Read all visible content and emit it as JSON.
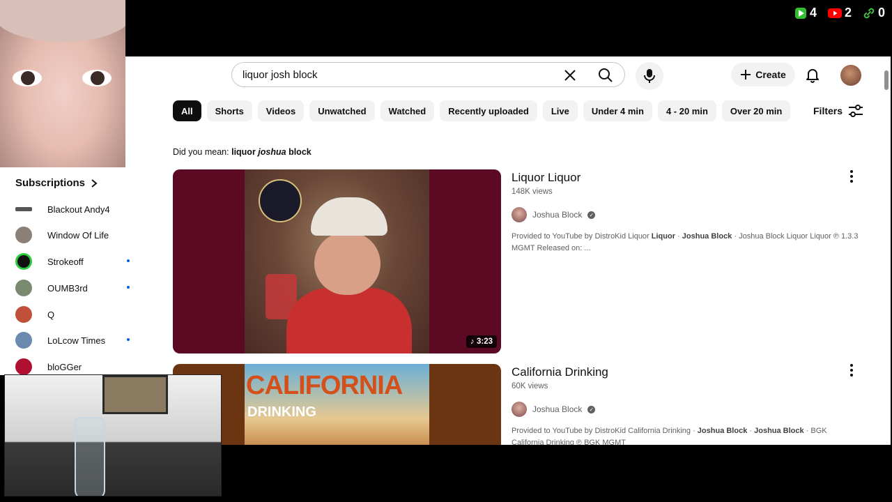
{
  "overlay": {
    "counters": [
      {
        "icon": "play-icon",
        "value": "4",
        "color": "#2fbf2f"
      },
      {
        "icon": "youtube-icon",
        "value": "2",
        "color": "#ff0000"
      },
      {
        "icon": "link-icon",
        "value": "0",
        "color": "#3fbf3f"
      }
    ]
  },
  "header": {
    "search_value": "liquor josh block",
    "create_label": "Create"
  },
  "chips": [
    "All",
    "Shorts",
    "Videos",
    "Unwatched",
    "Watched",
    "Recently uploaded",
    "Live",
    "Under 4 min",
    "4 - 20 min",
    "Over 20 min"
  ],
  "filters_label": "Filters",
  "did_you_mean": {
    "prefix": "Did you mean:",
    "part1": "liquor",
    "part2": "joshua",
    "part3": "block"
  },
  "results": [
    {
      "title": "Liquor Liquor",
      "views": "148K views",
      "channel": "Joshua Block",
      "duration": "3:23",
      "desc_a": "Provided to YouTube by DistroKid Liquor ",
      "desc_b": "Liquor",
      "desc_c": " · ",
      "desc_d": "Joshua Block",
      "desc_e": " · Joshua Block Liquor Liquor ℗ 1.3.3 MGMT Released on: ..."
    },
    {
      "title": "California Drinking",
      "views": "60K views",
      "channel": "Joshua Block",
      "thumb_text_1": "CALIFORNIA",
      "thumb_text_2": "DRINKING",
      "desc_a": "Provided to YouTube by DistroKid California Drinking · ",
      "desc_b": "Joshua Block",
      "desc_c": " · ",
      "desc_d": "Joshua Block",
      "desc_e": " · BGK California Drinking ℗ BGK MGMT"
    }
  ],
  "sidebar": {
    "heading": "Subscriptions",
    "items": [
      {
        "label": "Blackout Andy4",
        "new": false,
        "color": "#555555"
      },
      {
        "label": "Window Of Life",
        "new": false,
        "color": "#8a8078"
      },
      {
        "label": "Strokeoff",
        "new": true,
        "color": "#2ecc40"
      },
      {
        "label": "OUMB3rd",
        "new": true,
        "color": "#7a8a70"
      },
      {
        "label": "Q",
        "new": false,
        "color": "#c0503a"
      },
      {
        "label": "LoLcow Times",
        "new": true,
        "color": "#6a8ab0"
      },
      {
        "label": "bloGGer",
        "new": false,
        "color": "#b01030"
      }
    ]
  }
}
